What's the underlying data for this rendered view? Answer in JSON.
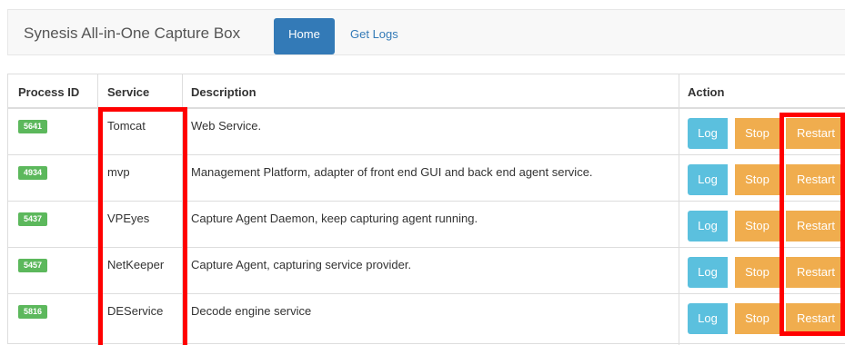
{
  "navbar": {
    "brand": "Synesis All-in-One Capture Box",
    "home_label": "Home",
    "logs_label": "Get Logs"
  },
  "table": {
    "headers": {
      "pid": "Process ID",
      "service": "Service",
      "description": "Description",
      "action": "Action"
    },
    "rows": [
      {
        "pid": "5641",
        "service": "Tomcat",
        "description": "Web Service.",
        "log": "Log",
        "stop": "Stop",
        "restart": "Restart"
      },
      {
        "pid": "4934",
        "service": "mvp",
        "description": "Management Platform, adapter of front end GUI and back end agent service.",
        "log": "Log",
        "stop": "Stop",
        "restart": "Restart"
      },
      {
        "pid": "5437",
        "service": "VPEyes",
        "description": "Capture Agent Daemon, keep capturing agent running.",
        "log": "Log",
        "stop": "Stop",
        "restart": "Restart"
      },
      {
        "pid": "5457",
        "service": "NetKeeper",
        "description": "Capture Agent, capturing service provider.",
        "log": "Log",
        "stop": "Stop",
        "restart": "Restart"
      },
      {
        "pid": "5816",
        "service": "DEService",
        "description": "Decode engine service",
        "log": "Log",
        "stop": "Stop",
        "restart": "Restart"
      }
    ]
  },
  "colors": {
    "primary": "#337ab7",
    "success_badge": "#5cb85c",
    "info_button": "#5bc0de",
    "warning_button": "#f0ad4e",
    "highlight": "#ff0000"
  }
}
